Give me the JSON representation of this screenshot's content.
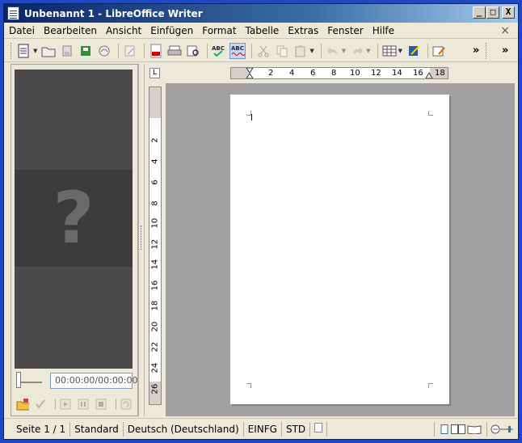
{
  "window": {
    "title": "Unbenannt 1 - LibreOffice Writer",
    "controls": {
      "minimize": "_",
      "maximize": "□",
      "close": "X"
    }
  },
  "menubar": {
    "items": [
      {
        "label": "Datei"
      },
      {
        "label": "Bearbeiten"
      },
      {
        "label": "Ansicht"
      },
      {
        "label": "Einfügen"
      },
      {
        "label": "Format"
      },
      {
        "label": "Tabelle"
      },
      {
        "label": "Extras"
      },
      {
        "label": "Fenster"
      },
      {
        "label": "Hilfe"
      }
    ],
    "close_doc": "×"
  },
  "toolbar": {
    "more": "»",
    "more_right": "»",
    "spell_label": "ABC"
  },
  "media_panel": {
    "placeholder_glyph": "?",
    "time": "00:00:00/00:00:00"
  },
  "ruler": {
    "h_numbers": [
      "2",
      "4",
      "6",
      "8",
      "10",
      "12",
      "14",
      "16",
      "18"
    ],
    "v_numbers": [
      "2",
      "4",
      "6",
      "8",
      "10",
      "12",
      "14",
      "16",
      "18",
      "20",
      "22",
      "24",
      "26"
    ],
    "corner": "L"
  },
  "statusbar": {
    "page": "Seite 1 / 1",
    "style": "Standard",
    "language": "Deutsch (Deutschland)",
    "insert_mode": "EINFG",
    "selection_mode": "STD"
  },
  "colors": {
    "title_start": "#0a246a",
    "chrome": "#ece9d8",
    "doc_background": "#a0a0a0"
  }
}
